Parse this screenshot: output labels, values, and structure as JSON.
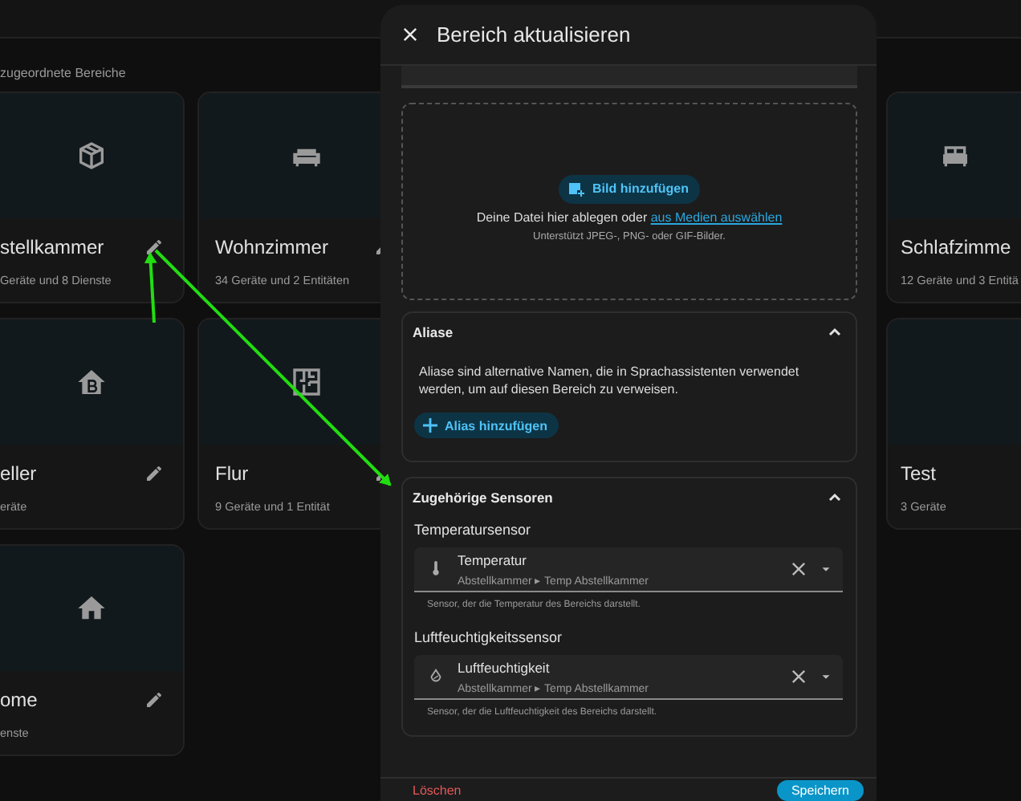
{
  "page": {
    "section_caption": "zugeordnete Bereiche"
  },
  "area_rows": [
    [
      {
        "name": "stellkammer",
        "details": "Geräte und 8 Dienste"
      },
      {
        "name": "Wohnzimmer",
        "details": "34 Geräte und 2 Entitäten"
      },
      {
        "name": "Schlafzimme",
        "details": "12 Geräte und 3 Entitä"
      }
    ],
    [
      {
        "name": "eller",
        "details": "eräte"
      },
      {
        "name": "Flur",
        "details": "9 Geräte und 1 Entität"
      },
      {
        "name": "Test",
        "details": "3 Geräte"
      }
    ],
    [
      {
        "name": "ome",
        "details": "enste"
      }
    ]
  ],
  "dialog": {
    "title": "Bereich aktualisieren",
    "picture_upload": {
      "button": "Bild hinzufügen",
      "prompt": "Deine Datei hier ablegen oder",
      "link": "aus Medien auswählen",
      "hint": "Unterstützt JPEG-, PNG- oder GIF-Bilder."
    },
    "aliases": {
      "title": "Aliase",
      "expanded": true,
      "description": "Aliase sind alternative Namen, die in Sprachassistenten verwendet werden, um auf diesen Bereich zu verweisen.",
      "button": "Alias hinzufügen"
    },
    "related_sensors": {
      "title": "Zugehörige Sensoren",
      "expanded": true,
      "sensors": [
        {
          "label": "Temperatursensor",
          "value": "Temperatur",
          "path": "Abstellkammer ▸ Temp Abstellkammer",
          "helper": "Sensor, der die Temperatur des Bereichs darstellt."
        },
        {
          "label": "Luftfeuchtigkeitssensor",
          "value": "Luftfeuchtigkeit",
          "path": "Abstellkammer ▸ Temp Abstellkammer",
          "helper": "Sensor, der die Luftfeuchtigkeit des Bereichs darstellt."
        }
      ]
    },
    "footer": {
      "delete": "Löschen",
      "save": "Speichern"
    }
  }
}
